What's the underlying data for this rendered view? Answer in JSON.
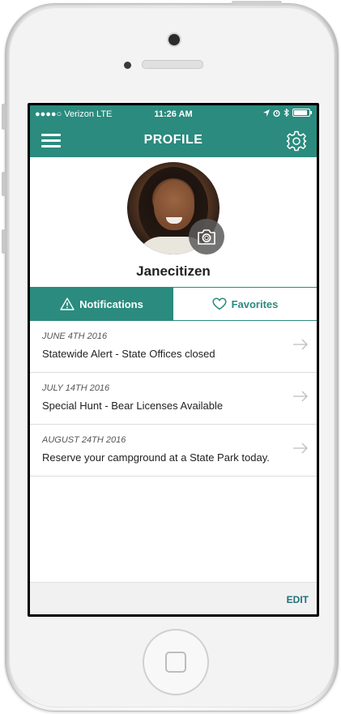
{
  "colors": {
    "accent": "#2a8b7e",
    "edit": "#1f6f78"
  },
  "statusbar": {
    "carrier": "●●●●○ Verizon  LTE",
    "time": "11:26 AM"
  },
  "navbar": {
    "title": "PROFILE",
    "menu_icon": "hamburger-menu-icon",
    "settings_icon": "gear-icon"
  },
  "profile": {
    "username": "Janecitizen",
    "camera_icon": "camera-icon"
  },
  "tabs": [
    {
      "label": "Notifications",
      "icon": "warning-icon",
      "active": true
    },
    {
      "label": "Favorites",
      "icon": "heart-icon",
      "active": false
    }
  ],
  "notifications": [
    {
      "date": "JUNE 4TH 2016",
      "title": "Statewide Alert - State Offices closed"
    },
    {
      "date": "JULY 14TH 2016",
      "title": "Special Hunt - Bear Licenses Available"
    },
    {
      "date": "AUGUST 24TH 2016",
      "title": "Reserve your campground at a State Park today."
    }
  ],
  "footer": {
    "edit_label": "EDIT"
  }
}
